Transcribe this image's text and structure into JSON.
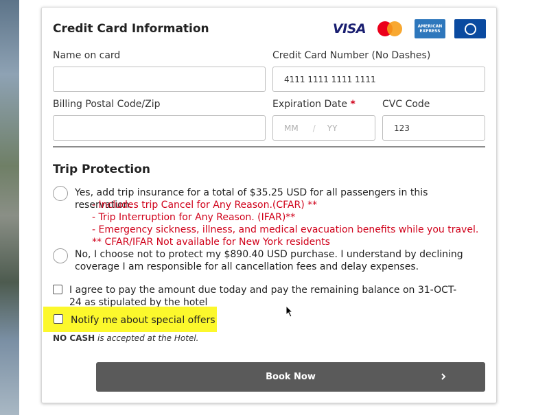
{
  "credit_card": {
    "title": "Credit Card Information",
    "logos": {
      "visa": "VISA",
      "amex_line1": "AMERICAN",
      "amex_line2": "EXPRESS",
      "mastercard_icon": "mastercard-icon",
      "diners_icon": "diners-club-icon"
    },
    "name_label": "Name on card",
    "name_value": "",
    "number_label": "Credit Card Number (No Dashes)",
    "number_value": "4111 1111 1111 1111",
    "postal_label": "Billing Postal Code/Zip",
    "postal_value": "",
    "expiration_label": "Expiration Date",
    "required_marker": "*",
    "exp_month_placeholder": "MM",
    "exp_slash": "/",
    "exp_year_placeholder": "YY",
    "cvc_label": "CVC Code",
    "cvc_value": "123"
  },
  "trip_protection": {
    "title": "Trip Protection",
    "yes_option": "Yes, add trip insurance for a total of $35.25 USD for all passengers in this reservation.",
    "benefits": [
      "- Includes trip Cancel for Any Reason.(CFAR) **",
      "- Trip Interruption for Any Reason. (IFAR)**",
      "- Emergency sickness, illness, and medical evacuation benefits while you travel.",
      "** CFAR/IFAR Not available for New York residents"
    ],
    "no_option": "No, I choose not to protect my $890.40 USD purchase. I understand by declining coverage I am responsible for all cancellation fees and delay expenses."
  },
  "agreement": {
    "pay_text": "I agree to pay the amount due today and pay the remaining balance on 31-OCT-24 as stipulated by the hotel",
    "pay_checked": false,
    "notify_text": "Notify me about special offers",
    "notify_checked": false,
    "highlight_color": "#fcf82c"
  },
  "note": {
    "bold": "NO CASH",
    "rest": "is accepted at the Hotel."
  },
  "book_button": {
    "label": "Book Now",
    "icon": "chevron-right-icon",
    "color": "#5a5a5a"
  }
}
